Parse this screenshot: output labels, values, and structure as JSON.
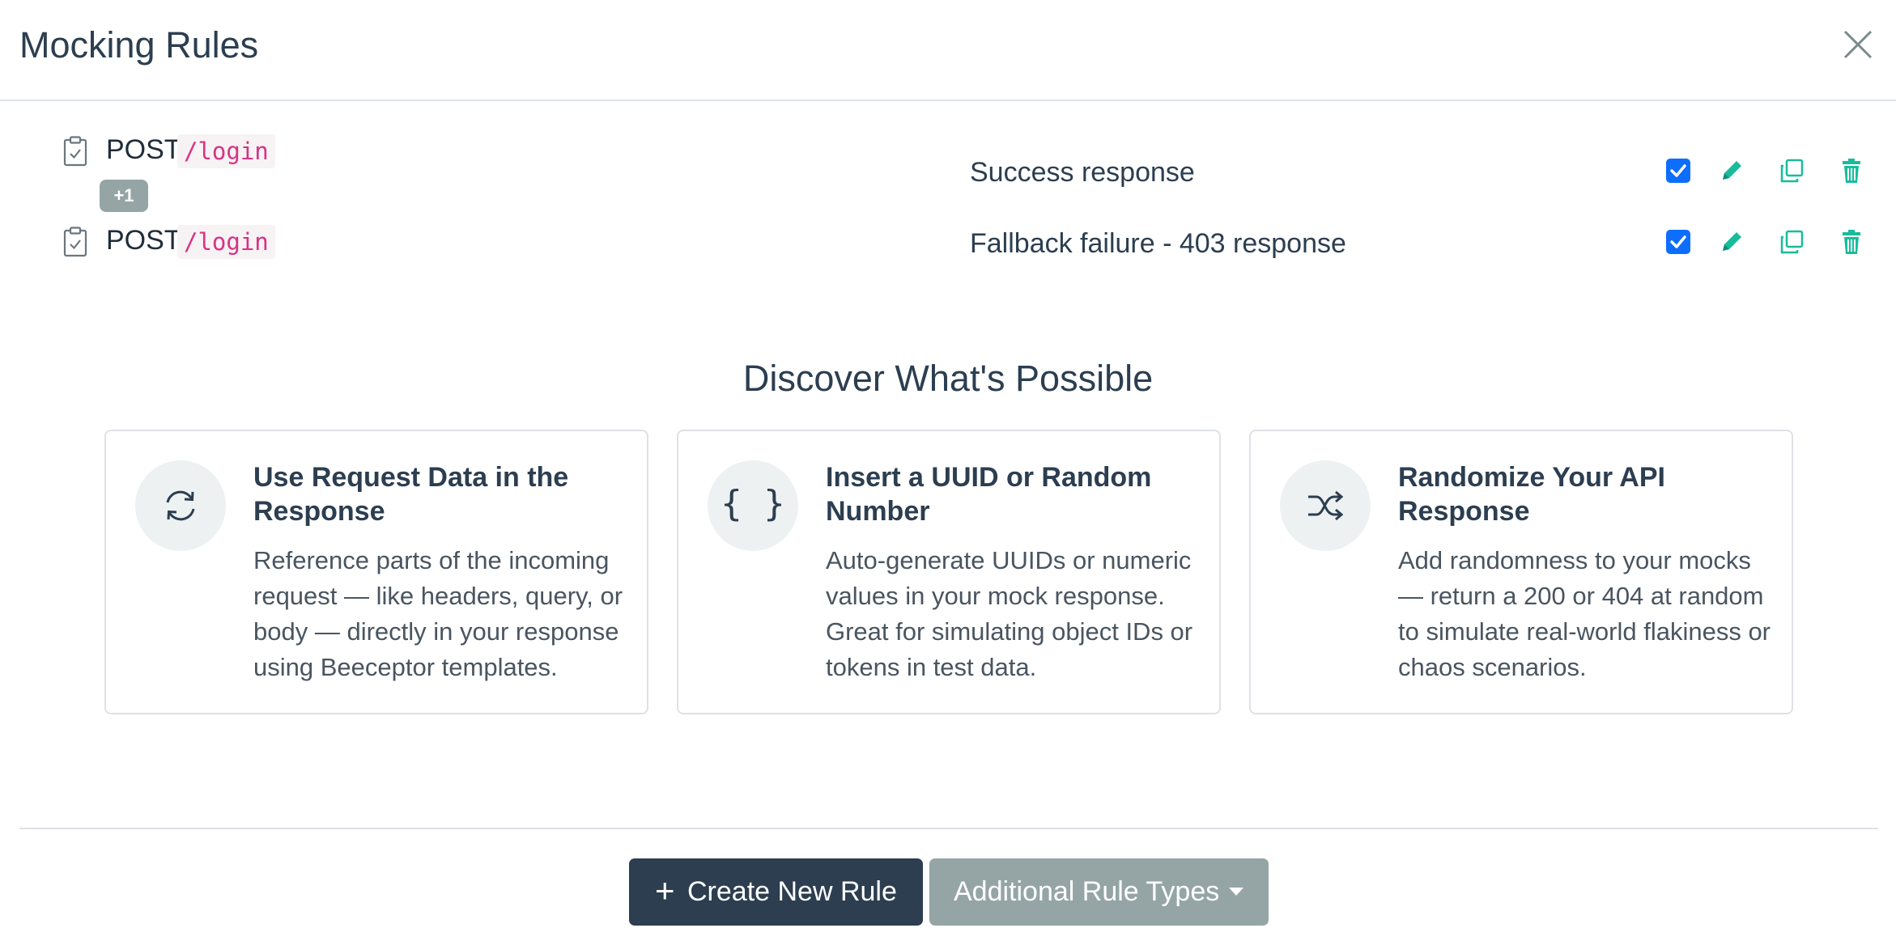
{
  "modal": {
    "title": "Mocking Rules",
    "close_icon": "close-icon"
  },
  "rules": [
    {
      "method": "POST",
      "path": "/login",
      "description": "Success response",
      "enabled": true,
      "badge": "+1"
    },
    {
      "method": "POST",
      "path": "/login",
      "description": "Fallback failure - 403 response",
      "enabled": true
    }
  ],
  "row_icons": {
    "rule": "clipboard-check-icon",
    "edit": "pencil-icon",
    "copy": "copy-icon",
    "delete": "trash-icon"
  },
  "discover": {
    "title": "Discover What's Possible",
    "cards": [
      {
        "icon": "refresh-icon",
        "title": "Use Request Data in the Response",
        "body": "Reference parts of the incoming request — like headers, query, or body — directly in your response using Beeceptor templates."
      },
      {
        "icon": "curly-braces-icon",
        "title": "Insert a UUID or Random Number",
        "body": "Auto-generate UUIDs or numeric values in your mock response. Great for simulating object IDs or tokens in test data."
      },
      {
        "icon": "shuffle-icon",
        "title": "Randomize Your API Response",
        "body": "Add randomness to your mocks — return a 200 or 404 at random to simulate real-world flakiness or chaos scenarios."
      }
    ]
  },
  "footer": {
    "create_label": "Create New Rule",
    "additional_label": "Additional Rule Types"
  },
  "colors": {
    "primary": "#2c3e50",
    "secondary": "#95a5a6",
    "action_green": "#18bc9c",
    "checkbox_blue": "#0d6efd",
    "path_pink": "#d63384"
  }
}
